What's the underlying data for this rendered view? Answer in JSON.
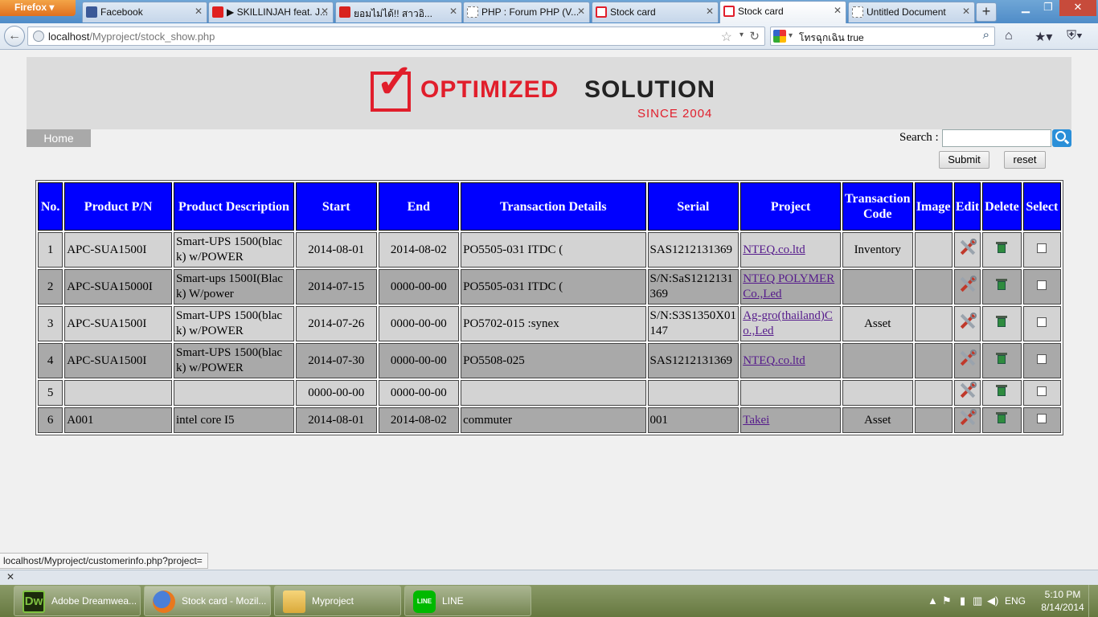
{
  "browser": {
    "menu_label": "Firefox",
    "tabs": [
      {
        "label": "Facebook",
        "icon": "facebook-icon"
      },
      {
        "label": "▶ SKILLINJAH feat. J...",
        "icon": "youtube-icon"
      },
      {
        "label": "ยอมไม่ได้!! สาวอิ...",
        "icon": "sanook-icon"
      },
      {
        "label": "PHP : Forum PHP (V...",
        "icon": "page-icon"
      },
      {
        "label": "Stock card",
        "icon": "checkbox-logo-icon"
      },
      {
        "label": "Stock card",
        "icon": "checkbox-logo-icon"
      },
      {
        "label": "Untitled Document",
        "icon": "page-icon"
      }
    ],
    "url_host": "localhost",
    "url_path": "/Myproject/stock_show.php",
    "search_value": "โทรฉุกเฉิน true",
    "status_url": "localhost/Myproject/customerinfo.php?project="
  },
  "page": {
    "logo": {
      "word1": "OPTIMIZED",
      "word2": "SOLUTION",
      "since": "SINCE 2004"
    },
    "home_label": "Home",
    "search_label": "Search :",
    "search_value": "",
    "submit_label": "Submit",
    "reset_label": "reset"
  },
  "table": {
    "headers": [
      "No.",
      "Product P/N",
      "Product Description",
      "Start",
      "End",
      "Transaction Details",
      "Serial",
      "Project",
      "Transaction Code",
      "Image",
      "Edit",
      "Delete",
      "Select"
    ],
    "rows": [
      {
        "no": "1",
        "pn": "APC-SUA1500I",
        "desc": "Smart-UPS 1500(black) w/POWER",
        "start": "2014-08-01",
        "end": "2014-08-02",
        "details": "PO5505-031 ITDC (",
        "serial": "SAS1212131369",
        "project": "NTEQ.co.ltd",
        "code": "Inventory",
        "image": ""
      },
      {
        "no": "2",
        "pn": "APC-SUA15000I",
        "desc": "Smart-ups 1500I(Black) W/power",
        "start": "2014-07-15",
        "end": "0000-00-00",
        "details": "PO5505-031 ITDC (",
        "serial": "S/N:SaS1212131369",
        "project": "NTEQ POLYMER Co.,Led",
        "code": "",
        "image": ""
      },
      {
        "no": "3",
        "pn": "APC-SUA1500I",
        "desc": "Smart-UPS 1500(black) w/POWER",
        "start": "2014-07-26",
        "end": "0000-00-00",
        "details": "PO5702-015 :synex",
        "serial": "S/N:S3S1350X01147",
        "project": "Ag-gro(thailand)Co.,Led",
        "code": "Asset",
        "image": ""
      },
      {
        "no": "4",
        "pn": "APC-SUA1500I",
        "desc": "Smart-UPS 1500(black) w/POWER",
        "start": "2014-07-30",
        "end": "0000-00-00",
        "details": "PO5508-025",
        "serial": "SAS1212131369",
        "project": "NTEQ.co.ltd",
        "code": "",
        "image": ""
      },
      {
        "no": "5",
        "pn": "",
        "desc": "",
        "start": "0000-00-00",
        "end": "0000-00-00",
        "details": "",
        "serial": "",
        "project": "",
        "code": "",
        "image": ""
      },
      {
        "no": "6",
        "pn": "A001",
        "desc": "intel core I5",
        "start": "2014-08-01",
        "end": "2014-08-02",
        "details": "commuter",
        "serial": "001",
        "project": "Takei",
        "code": "Asset",
        "image": ""
      }
    ]
  },
  "taskbar": {
    "items": [
      {
        "label": "Adobe Dreamwea...",
        "icon": "dreamweaver-icon",
        "icon_text": "Dw"
      },
      {
        "label": "Stock card - Mozil...",
        "icon": "firefox-icon"
      },
      {
        "label": "Myproject",
        "icon": "folder-icon"
      },
      {
        "label": "LINE",
        "icon": "line-icon",
        "icon_text": "LINE"
      }
    ],
    "language": "ENG",
    "time": "5:10 PM",
    "date": "8/14/2014"
  },
  "colors": {
    "header_blue": "#0000ff",
    "row_light": "#d3d3d3",
    "row_dark": "#a9a9a9",
    "logo_red": "#e11e2b"
  }
}
